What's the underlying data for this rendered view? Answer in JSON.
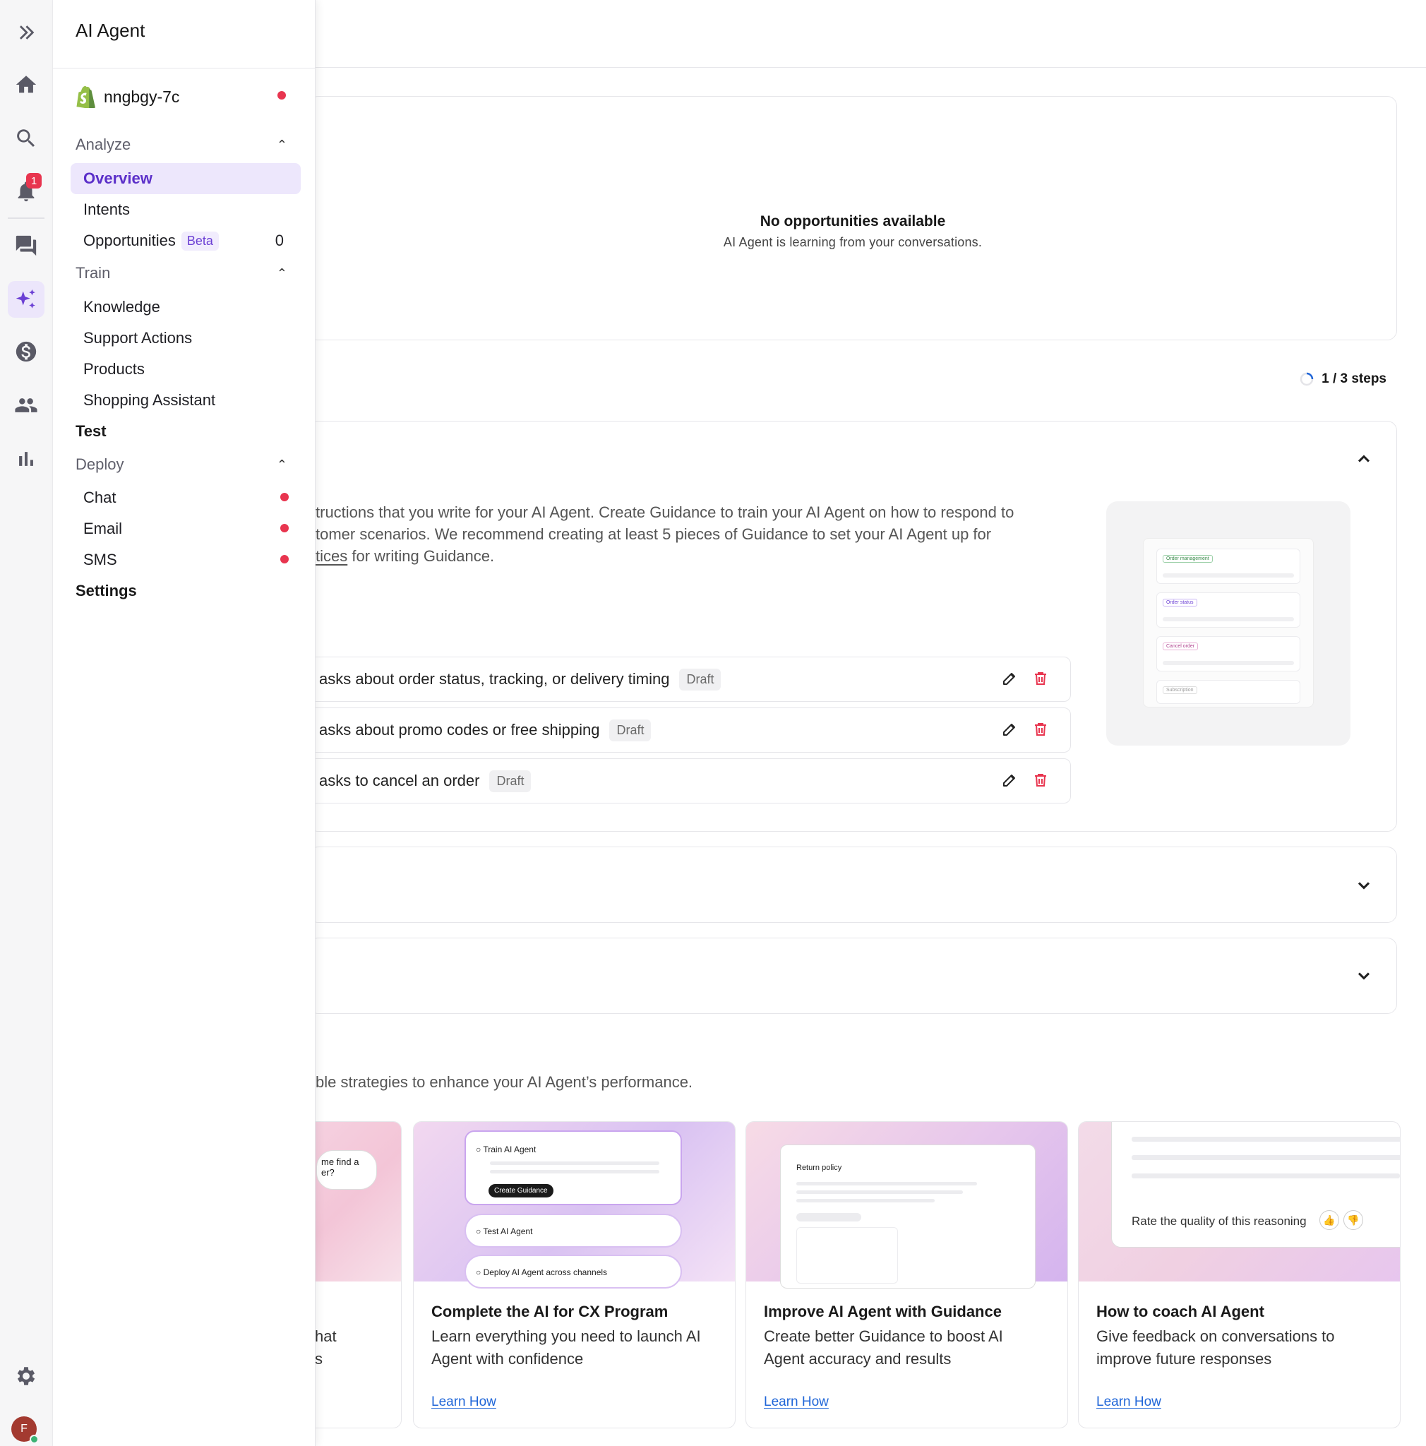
{
  "rail": {
    "notification_count": "1",
    "avatar_initial": "F",
    "icons": [
      "expand-icon",
      "home-icon",
      "search-icon",
      "bell-icon",
      "chat-icon",
      "ai-sparkle-icon",
      "dollar-icon",
      "users-icon",
      "stats-icon",
      "settings-gear-icon"
    ]
  },
  "nav": {
    "title": "AI Agent",
    "store": "nngbgy-7c",
    "analyze": {
      "label": "Analyze",
      "items": [
        "Overview",
        "Intents",
        "Opportunities"
      ],
      "beta": "Beta",
      "opportunities_count": "0"
    },
    "train": {
      "label": "Train",
      "items": [
        "Knowledge",
        "Support Actions",
        "Products",
        "Shopping Assistant"
      ]
    },
    "test": "Test",
    "deploy": {
      "label": "Deploy",
      "items": [
        "Chat",
        "Email",
        "SMS"
      ]
    },
    "settings": "Settings"
  },
  "opportunities": {
    "title": "No opportunities available",
    "subtitle": "AI Agent is learning from your conversations."
  },
  "setup": {
    "steps": "1 / 3 steps",
    "description_line1": "tructions that you write for your AI Agent. Create Guidance to train your AI Agent on how to respond to",
    "description_line2": "tomer scenarios. We recommend creating at least 5 pieces of Guidance to set your AI Agent up for",
    "description_link": "tices",
    "description_tail": " for writing Guidance.",
    "guidance": [
      {
        "text": "asks about order status, tracking, or delivery timing",
        "status": "Draft"
      },
      {
        "text": "asks about promo codes or free shipping",
        "status": "Draft"
      },
      {
        "text": "asks to cancel an order",
        "status": "Draft"
      }
    ],
    "illustration_labels": [
      "Order management",
      "Order status",
      "Cancel order",
      "Subscription"
    ]
  },
  "resources": {
    "intro": "ble strategies to enhance your AI Agent’s performance.",
    "partial_card": {
      "bubble": "me find a\ner?",
      "desc": "hat\ns"
    },
    "cards": [
      {
        "title": "Complete the AI for CX Program",
        "desc": "Learn everything you need to launch AI Agent with confidence",
        "link": "Learn How",
        "steps": [
          "Train AI Agent",
          "Create Guidance",
          "Test AI Agent",
          "Deploy AI Agent across channels"
        ]
      },
      {
        "title": "Improve AI Agent with Guidance",
        "desc": "Create better Guidance to boost AI Agent accuracy and results",
        "link": "Learn How",
        "panel_title": "Return policy"
      },
      {
        "title": "How to coach AI Agent",
        "desc": "Give feedback on conversations to improve future responses",
        "link": "Learn How",
        "rate_label": "Rate the quality of this reasoning"
      }
    ]
  },
  "colors": {
    "accent": "#6b3fd4",
    "danger": "#e8354f",
    "link": "#2066d8"
  }
}
